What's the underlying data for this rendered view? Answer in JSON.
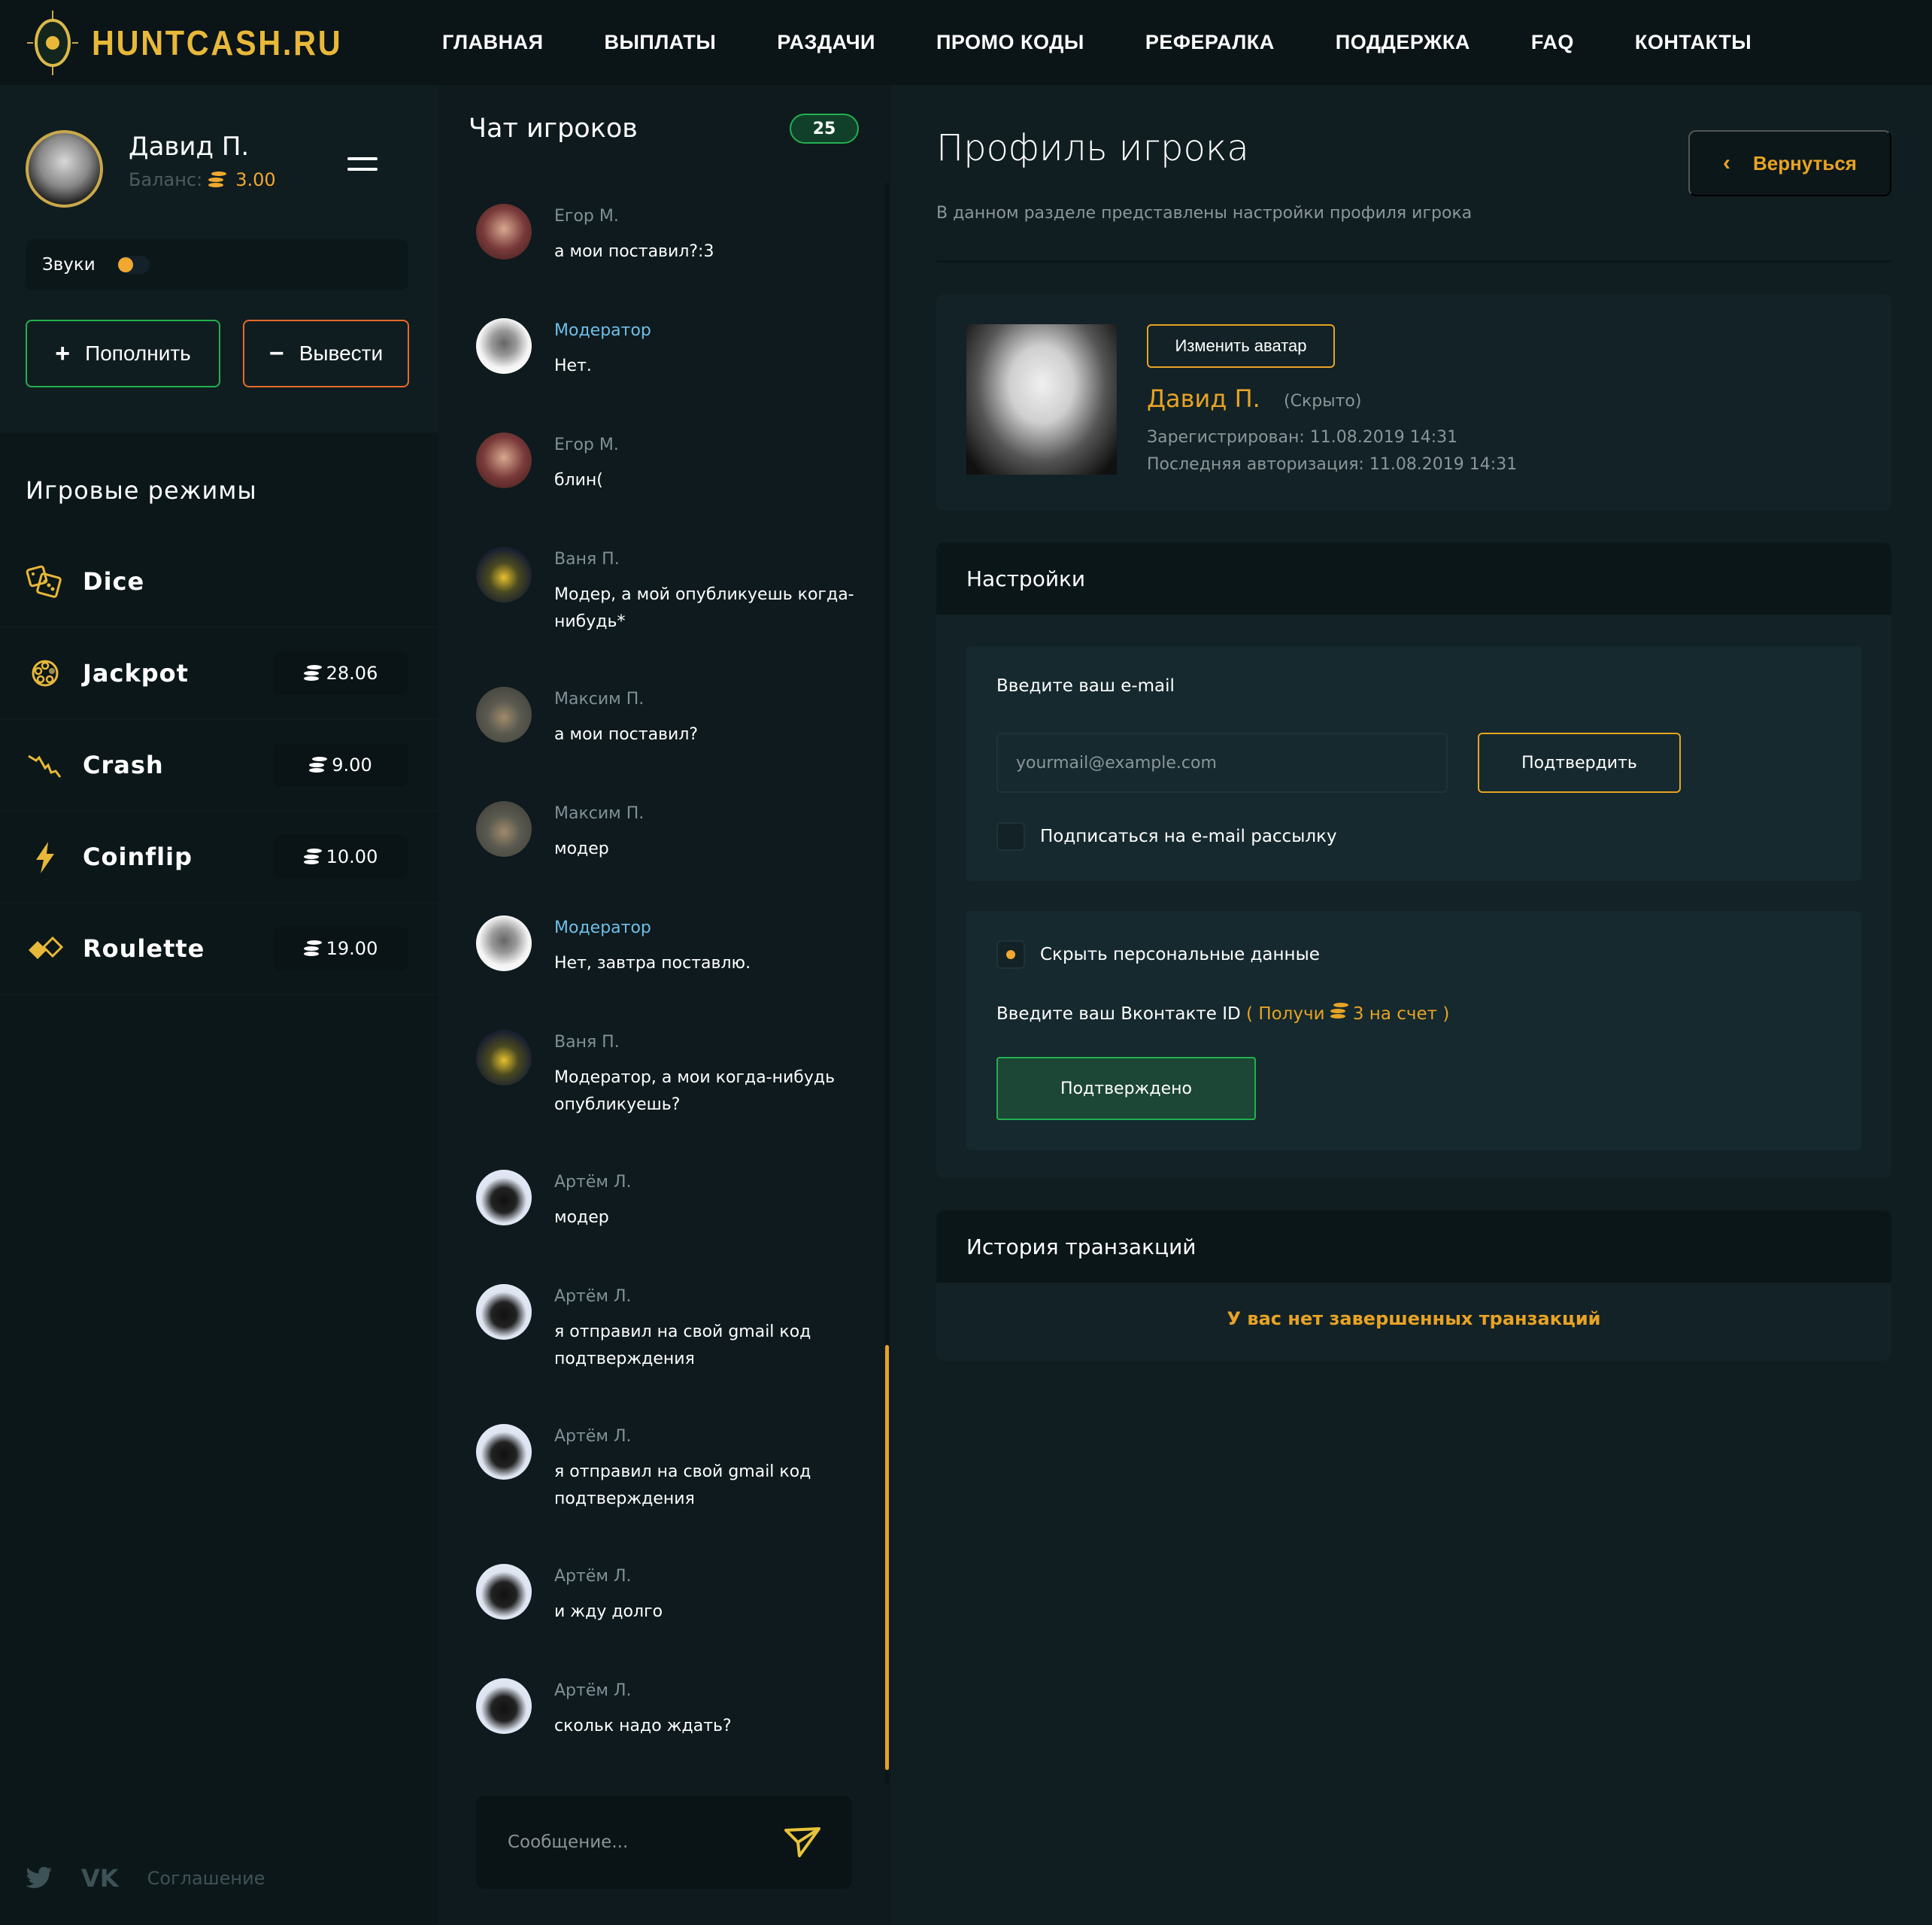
{
  "brand": {
    "name": "HUNTCASH.RU",
    "logo_icon": "target-coin-icon"
  },
  "nav": [
    "ГЛАВНАЯ",
    "ВЫПЛАТЫ",
    "РАЗДАЧИ",
    "ПРОМО КОДЫ",
    "РЕФЕРАЛКА",
    "ПОДДЕРЖКА",
    "FAQ",
    "КОНТАКТЫ"
  ],
  "user": {
    "name": "Давид П.",
    "balance_label": "Баланс:",
    "balance": "3.00",
    "sound_label": "Звуки",
    "sound_on": true,
    "deposit_label": "Пополнить",
    "withdraw_label": "Вывести"
  },
  "games": {
    "title": "Игровые режимы",
    "items": [
      {
        "name": "Dice",
        "icon": "dice-icon",
        "amount": null
      },
      {
        "name": "Jackpot",
        "icon": "jackpot-icon",
        "amount": "28.06"
      },
      {
        "name": "Crash",
        "icon": "crash-icon",
        "amount": "9.00"
      },
      {
        "name": "Coinflip",
        "icon": "lightning-icon",
        "amount": "10.00"
      },
      {
        "name": "Roulette",
        "icon": "roulette-icon",
        "amount": "19.00"
      }
    ]
  },
  "footer": {
    "agreement": "Соглашение",
    "social": [
      "twitter-icon",
      "vk-icon"
    ]
  },
  "chat": {
    "title": "Чат игроков",
    "online": "25",
    "placeholder": "Сообщение...",
    "messages": [
      {
        "name": "Егор М.",
        "text": "а мои поставил?:3",
        "mod": false
      },
      {
        "name": "Модератор",
        "text": "Нет.",
        "mod": true
      },
      {
        "name": "Егор М.",
        "text": "блин(",
        "mod": false
      },
      {
        "name": "Ваня П.",
        "text": "Модер, а мой опубликуешь когда-нибудь*",
        "mod": false
      },
      {
        "name": "Максим П.",
        "text": "а мои поставил?",
        "mod": false
      },
      {
        "name": "Максим П.",
        "text": "модер",
        "mod": false
      },
      {
        "name": "Модератор",
        "text": "Нет, завтра поставлю.",
        "mod": true
      },
      {
        "name": "Ваня П.",
        "text": "Модератор, а мои когда-нибудь опубликуешь?",
        "mod": false
      },
      {
        "name": "Артём Л.",
        "text": "модер",
        "mod": false
      },
      {
        "name": "Артём Л.",
        "text": "я отправил на свой gmail код подтверждения",
        "mod": false
      },
      {
        "name": "Артём Л.",
        "text": "я отправил на свой gmail код подтверждения",
        "mod": false
      },
      {
        "name": "Артём Л.",
        "text": "и жду долго",
        "mod": false
      },
      {
        "name": "Артём Л.",
        "text": "скольк надо ждать?",
        "mod": false
      }
    ]
  },
  "profile": {
    "title": "Профиль игрока",
    "subtitle": "В данном разделе представлены настройки профиля игрока",
    "back_label": "Вернуться",
    "change_avatar_label": "Изменить аватар",
    "name": "Давид П.",
    "hidden_label": "(Скрыто)",
    "registered": "Зарегистрирован: 11.08.2019 14:31",
    "last_login": "Последняя авторизация: 11.08.2019 14:31"
  },
  "settings": {
    "title": "Настройки",
    "email_label": "Введите ваш e-mail",
    "email_value": "",
    "email_placeholder": "yourmail@example.com",
    "confirm_label": "Подтвердить",
    "subscribe_label": "Подписаться на e-mail рассылку",
    "subscribe_checked": false,
    "hide_label": "Скрыть персональные данные",
    "hide_checked": true,
    "vk_label": "Введите ваш Вконтакте ID",
    "vk_bonus_prefix": "( Получи",
    "vk_bonus_suffix": "3 на счет )",
    "verified_label": "Подтверждено"
  },
  "history": {
    "title": "История транзакций",
    "empty": "У вас нет завершенных транзакций"
  },
  "colors": {
    "accent": "#e8a324",
    "green": "#23b04e",
    "orange": "#e8692a",
    "mod_name": "#6fbfe9"
  }
}
